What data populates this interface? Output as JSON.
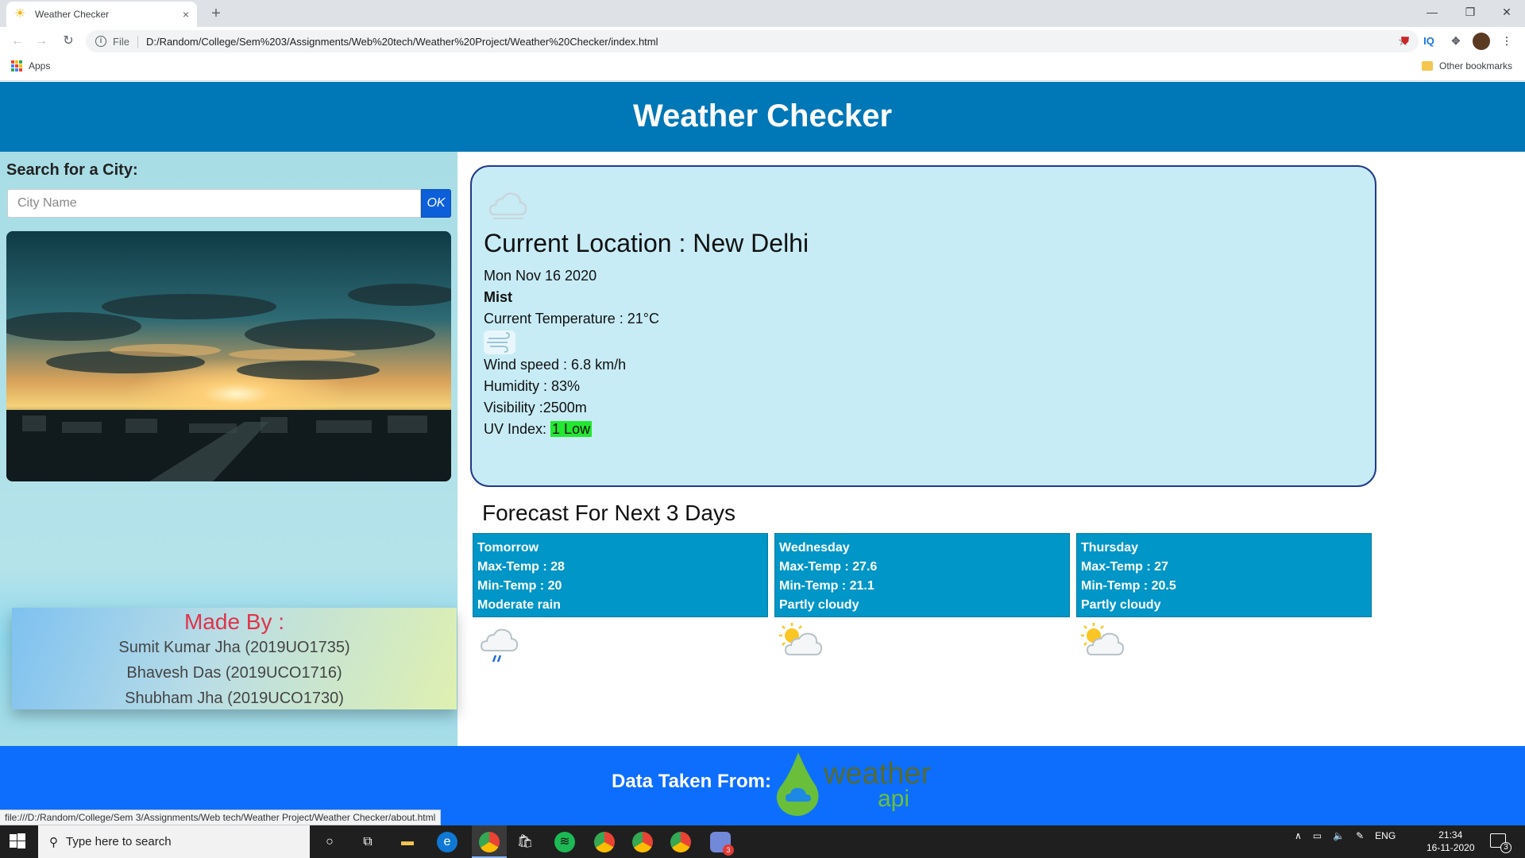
{
  "browser": {
    "tab_title": "Weather Checker",
    "tab_close": "×",
    "new_tab": "+",
    "file_label": "File",
    "url": "D:/Random/College/Sem%203/Assignments/Web%20tech/Weather%20Project/Weather%20Checker/index.html",
    "apps_label": "Apps",
    "other_bookmarks": "Other bookmarks",
    "ext_iq": "IQ",
    "status_url": "file:///D:/Random/College/Sem 3/Assignments/Web tech/Weather Project/Weather Checker/about.html"
  },
  "header": {
    "title": "Weather Checker"
  },
  "search": {
    "label": "Search for a City:",
    "placeholder": "City Name",
    "button": "OK"
  },
  "credits": {
    "title": "Made By :",
    "members": [
      "Sumit Kumar Jha (2019UO1735)",
      "Bhavesh Das (2019UCO1716)",
      "Shubham Jha (2019UCO1730)"
    ]
  },
  "current": {
    "location": "Current Location : New Delhi",
    "date": "Mon Nov 16 2020",
    "condition": "Mist",
    "temperature": "Current Temperature : 21°C",
    "wind": "Wind speed : 6.8 km/h",
    "humidity": "Humidity : 83%",
    "visibility": "Visibility :2500m",
    "uv_label": "UV Index: ",
    "uv_value": "1 Low",
    "uv_color": "#22e830"
  },
  "forecast": {
    "title": "Forecast For Next 3 Days",
    "days": [
      {
        "day": "Tomorrow",
        "max": "Max-Temp : 28",
        "min": "Min-Temp : 20",
        "condition": "Moderate rain",
        "icon": "rain-cloud-icon"
      },
      {
        "day": "Wednesday",
        "max": "Max-Temp : 27.6",
        "min": "Min-Temp : 21.1",
        "condition": "Partly cloudy",
        "icon": "partly-cloudy-icon"
      },
      {
        "day": "Thursday",
        "max": "Max-Temp : 27",
        "min": "Min-Temp : 20.5",
        "condition": "Partly cloudy",
        "icon": "partly-cloudy-icon"
      }
    ]
  },
  "footer": {
    "data_from": "Data Taken From:",
    "logo_word1": "weather",
    "logo_word2": "api"
  },
  "taskbar": {
    "search_placeholder": "Type here to search",
    "language": "ENG",
    "time": "21:34",
    "date": "16-11-2020",
    "notif_count": "3",
    "discord_badge": "3"
  },
  "colors": {
    "header_bg": "#0077b6",
    "forecast_bg": "#0096c7",
    "footer_bg": "#0d6efd",
    "card_bg": "#c7ecf5",
    "credits_title": "#e0344a"
  }
}
